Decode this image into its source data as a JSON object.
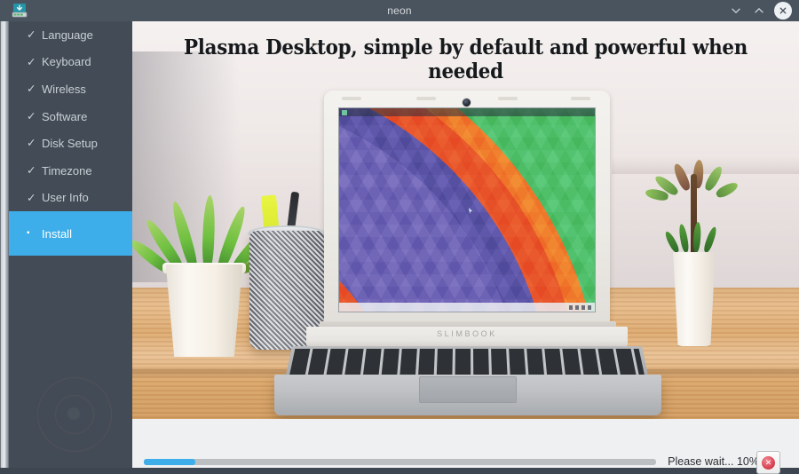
{
  "window": {
    "title": "neon",
    "app_icon": "installer-disk-icon",
    "controls": {
      "minimize_label": "∨",
      "maximize_label": "∧",
      "close_label": "✕"
    }
  },
  "sidebar": {
    "items": [
      {
        "label": "Language",
        "mark": "✓",
        "state": "done"
      },
      {
        "label": "Keyboard",
        "mark": "✓",
        "state": "done"
      },
      {
        "label": "Wireless",
        "mark": "✓",
        "state": "done"
      },
      {
        "label": "Software",
        "mark": "✓",
        "state": "done"
      },
      {
        "label": "Disk Setup",
        "mark": "✓",
        "state": "done"
      },
      {
        "label": "Timezone",
        "mark": "✓",
        "state": "done"
      },
      {
        "label": "User Info",
        "mark": "✓",
        "state": "done"
      },
      {
        "label": "Install",
        "mark": "▪",
        "state": "active"
      }
    ]
  },
  "slide": {
    "title": "Plasma Desktop, simple by default and powerful when needed",
    "laptop_brand": "SLIMBOOK"
  },
  "footer": {
    "progress_percent": 10,
    "progress_width": "10%",
    "status_text": "Please wait... 10%",
    "cancel_icon": "cancel-circle-icon",
    "cancel_glyph": "✕"
  },
  "colors": {
    "accent": "#3daee9",
    "sidebar_bg": "#434c56",
    "titlebar_bg": "#4a545f",
    "panel_bg": "#eff0f1",
    "progress_track": "#bcbfc2",
    "cancel_red": "#da4453"
  }
}
